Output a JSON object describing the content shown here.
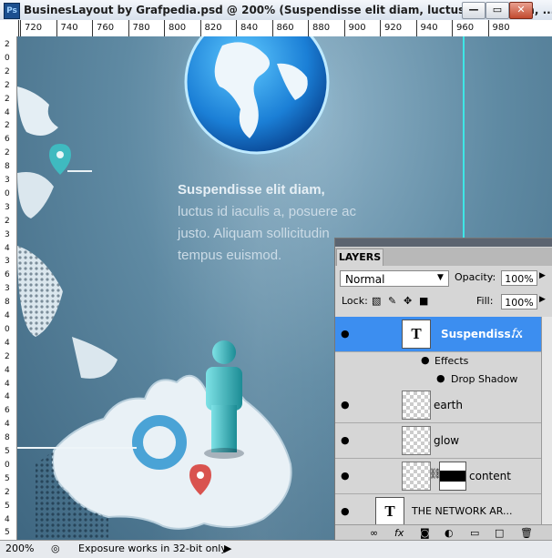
{
  "window": {
    "app_icon": "Ps",
    "title": "BusinesLayout by Grafpedia.psd @ 200% (Suspendisse elit diam, luctus id iaculis a, ...",
    "minimize": "—",
    "restore": "▭",
    "close": "✕"
  },
  "ruler": {
    "top_ticks": [
      "720",
      "740",
      "760",
      "780",
      "800",
      "820",
      "840",
      "860",
      "880",
      "900",
      "920",
      "940",
      "960",
      "980"
    ],
    "left_digits": [
      "2",
      "0",
      "2",
      "2",
      "2",
      "4",
      "2",
      "6",
      "2",
      "8",
      "3",
      "0",
      "3",
      "2",
      "3",
      "4",
      "3",
      "6",
      "3",
      "8",
      "4",
      "0",
      "4",
      "2",
      "4",
      "4",
      "4",
      "6",
      "4",
      "8",
      "5",
      "0",
      "5",
      "2",
      "5",
      "4",
      "5",
      "6"
    ]
  },
  "canvas": {
    "body_bold": "Suspendisse elit diam,",
    "body_rest": " luctus id iaculis a, posuere ac justo. Aliquam sollicitudin tempus euismod.",
    "accent_color": "#3ee6e6"
  },
  "layers_panel": {
    "tab": "LAYERS",
    "blend_mode": "Normal",
    "opacity_label": "Opacity:",
    "opacity_value": "100%",
    "lock_label": "Lock:",
    "fill_label": "Fill:",
    "fill_value": "100%",
    "layers": [
      {
        "name": "Suspendiss...",
        "type": "text",
        "selected": true,
        "fx": true
      },
      {
        "name": "earth",
        "type": "raster"
      },
      {
        "name": "glow",
        "type": "raster"
      },
      {
        "name": "content",
        "type": "masked"
      },
      {
        "name": "THE NETWORK AR...",
        "type": "text"
      }
    ],
    "effects_label": "Effects",
    "drop_shadow_label": "Drop Shadow",
    "fx_label": "fx",
    "thumb_glyph": "T"
  },
  "statusbar": {
    "zoom": "200%",
    "message": "Exposure works in 32-bit only"
  }
}
